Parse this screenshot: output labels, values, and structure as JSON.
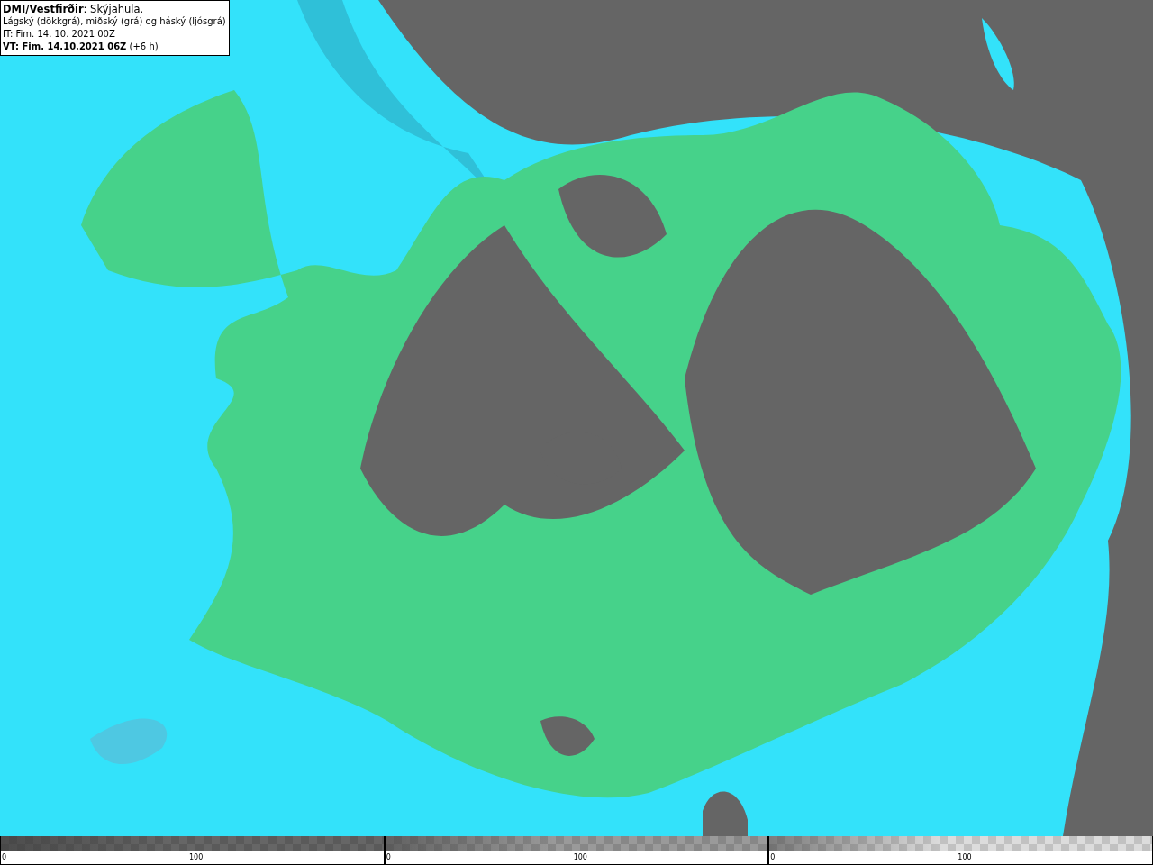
{
  "legend": {
    "lines": [
      "**DMI/Vestfirðir**: Skýjahula.",
      "Lágský (dökkgrá), miðský (grá) og háský (ljósgrá)",
      "IT: Fim. 14. 10. 2021 00Z",
      "**VT: Fim. 14.10.2021 06Z** (+6 h)"
    ]
  },
  "colorbars": [
    {
      "kind": "low",
      "min_label": "0",
      "mid_label": "100"
    },
    {
      "kind": "mid",
      "min_label": "0",
      "mid_label": "100"
    },
    {
      "kind": "high",
      "min_label": "0",
      "mid_label": "100"
    }
  ]
}
